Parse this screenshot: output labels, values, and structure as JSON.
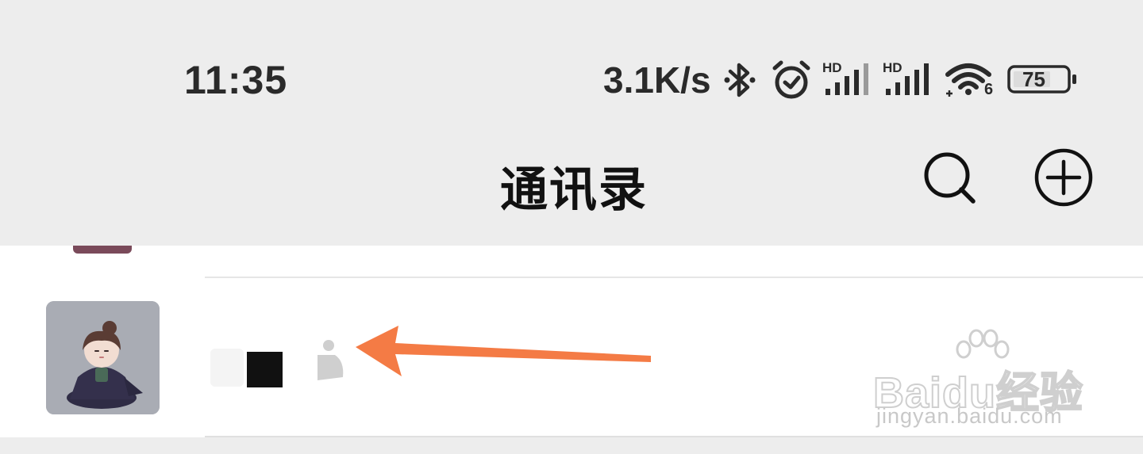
{
  "status_bar": {
    "time": "11:35",
    "network_speed": "3.1K/s",
    "signal1_label": "HD",
    "signal2_label": "HD",
    "wifi_label": "6",
    "battery": "75",
    "icons": [
      "bluetooth-icon",
      "alarm-icon",
      "signal-icon",
      "signal-icon",
      "wifi-icon",
      "battery-icon"
    ]
  },
  "nav": {
    "title": "通讯录",
    "search_icon": "search-icon",
    "add_icon": "add-circle-icon"
  },
  "contact": {
    "avatar": "anime-girl-avatar"
  },
  "watermark": {
    "brand_text": "Baidu经验",
    "url": "jingyan.baidu.com"
  },
  "colors": {
    "background": "#ededed",
    "list_background": "#ffffff",
    "arrow": "#f47b45",
    "text": "#111111"
  }
}
